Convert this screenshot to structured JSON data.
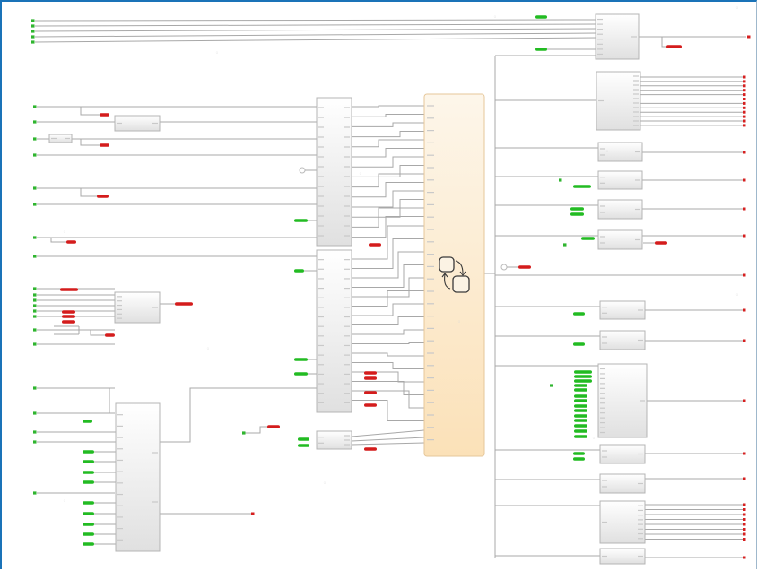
{
  "diagram": {
    "title": "",
    "chart_block": {
      "icon": "stateflow-chart-icon"
    },
    "colors": {
      "background": "#ffffff",
      "frame_border": "#1a73b8",
      "wire": "#a8a8a8",
      "block_fill_top": "#ffffff",
      "block_fill_bottom": "#e2e2e2",
      "chart_fill_top": "#fdf5e8",
      "chart_fill_bottom": "#fbe3bd",
      "goto_tag": "#22bb22",
      "from_tag": "#d41c1c",
      "inport": "#2fb52f",
      "outport": "#d61f1f"
    },
    "watermark": {
      "icon": "watermark-icon"
    }
  }
}
